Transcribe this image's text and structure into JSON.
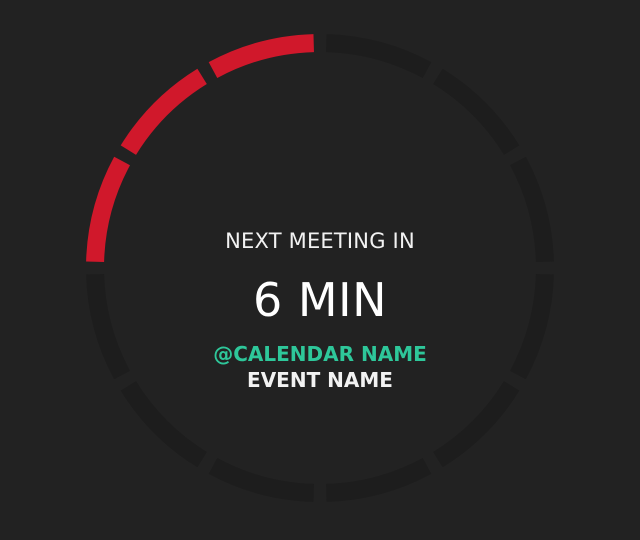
{
  "widget": {
    "heading": "NEXT MEETING IN",
    "time_remaining": "6 MIN",
    "calendar_name": "@CALENDAR NAME",
    "event_name": "EVENT NAME"
  },
  "ring": {
    "segment_count": 12,
    "active_segments": 3,
    "active_direction": "counter-clockwise from top",
    "active_color": "#d0182b",
    "inactive_color": "#1d1d1d",
    "background_color": "#222222"
  },
  "colors": {
    "heading": "#f2f2f2",
    "time": "#ffffff",
    "calendar": "#2ec79a",
    "event": "#f2f2f2"
  }
}
